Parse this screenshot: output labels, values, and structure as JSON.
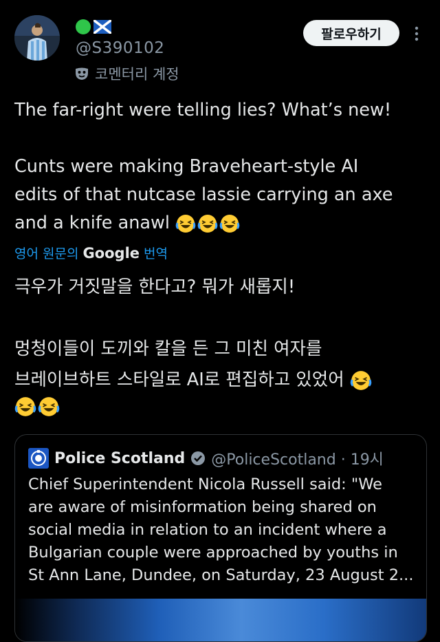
{
  "author": {
    "handle": "@S390102",
    "label": "코멘터리 계정"
  },
  "actions": {
    "follow_label": "팔로우하기"
  },
  "tweet": {
    "line1": "The far-right were telling lies? What’s new!",
    "para2_line1": "Cunts were making Braveheart-style AI",
    "para2_line2": "edits of that nutcase lassie carrying an axe",
    "para2_line3": "and a knife anawl"
  },
  "translation": {
    "prefix": "영어 원문의",
    "brand": "Google",
    "suffix": "번역",
    "line1": "극우가 거짓말을 한다고? 뭐가 새롭지!",
    "line2": "멍청이들이 도끼와 칼을 든 그 미친 여자를",
    "line3": "브레이브하트 스타일로 AI로 편집하고 있었어"
  },
  "quoted": {
    "name": "Police Scotland",
    "handle": "@PoliceScotland · 19시",
    "lines": [
      "Chief Superintendent Nicola Russell said: \"We",
      "are aware of misinformation being shared on",
      "social media in relation to an incident where a",
      "Bulgarian couple were approached by youths in",
      "St Ann Lane, Dundee, on Saturday, 23 August 2..."
    ]
  },
  "icons": [
    "green-circle-icon",
    "scotland-flag-icon",
    "commentary-mask-icon",
    "more-options-icon",
    "laughing-emoji-icon",
    "police-crest-icon",
    "verified-badge-icon"
  ],
  "colors": {
    "background": "#000000",
    "accent": "#1d9bf0",
    "muted": "#8b98a5",
    "text": "#e7e9ea"
  }
}
